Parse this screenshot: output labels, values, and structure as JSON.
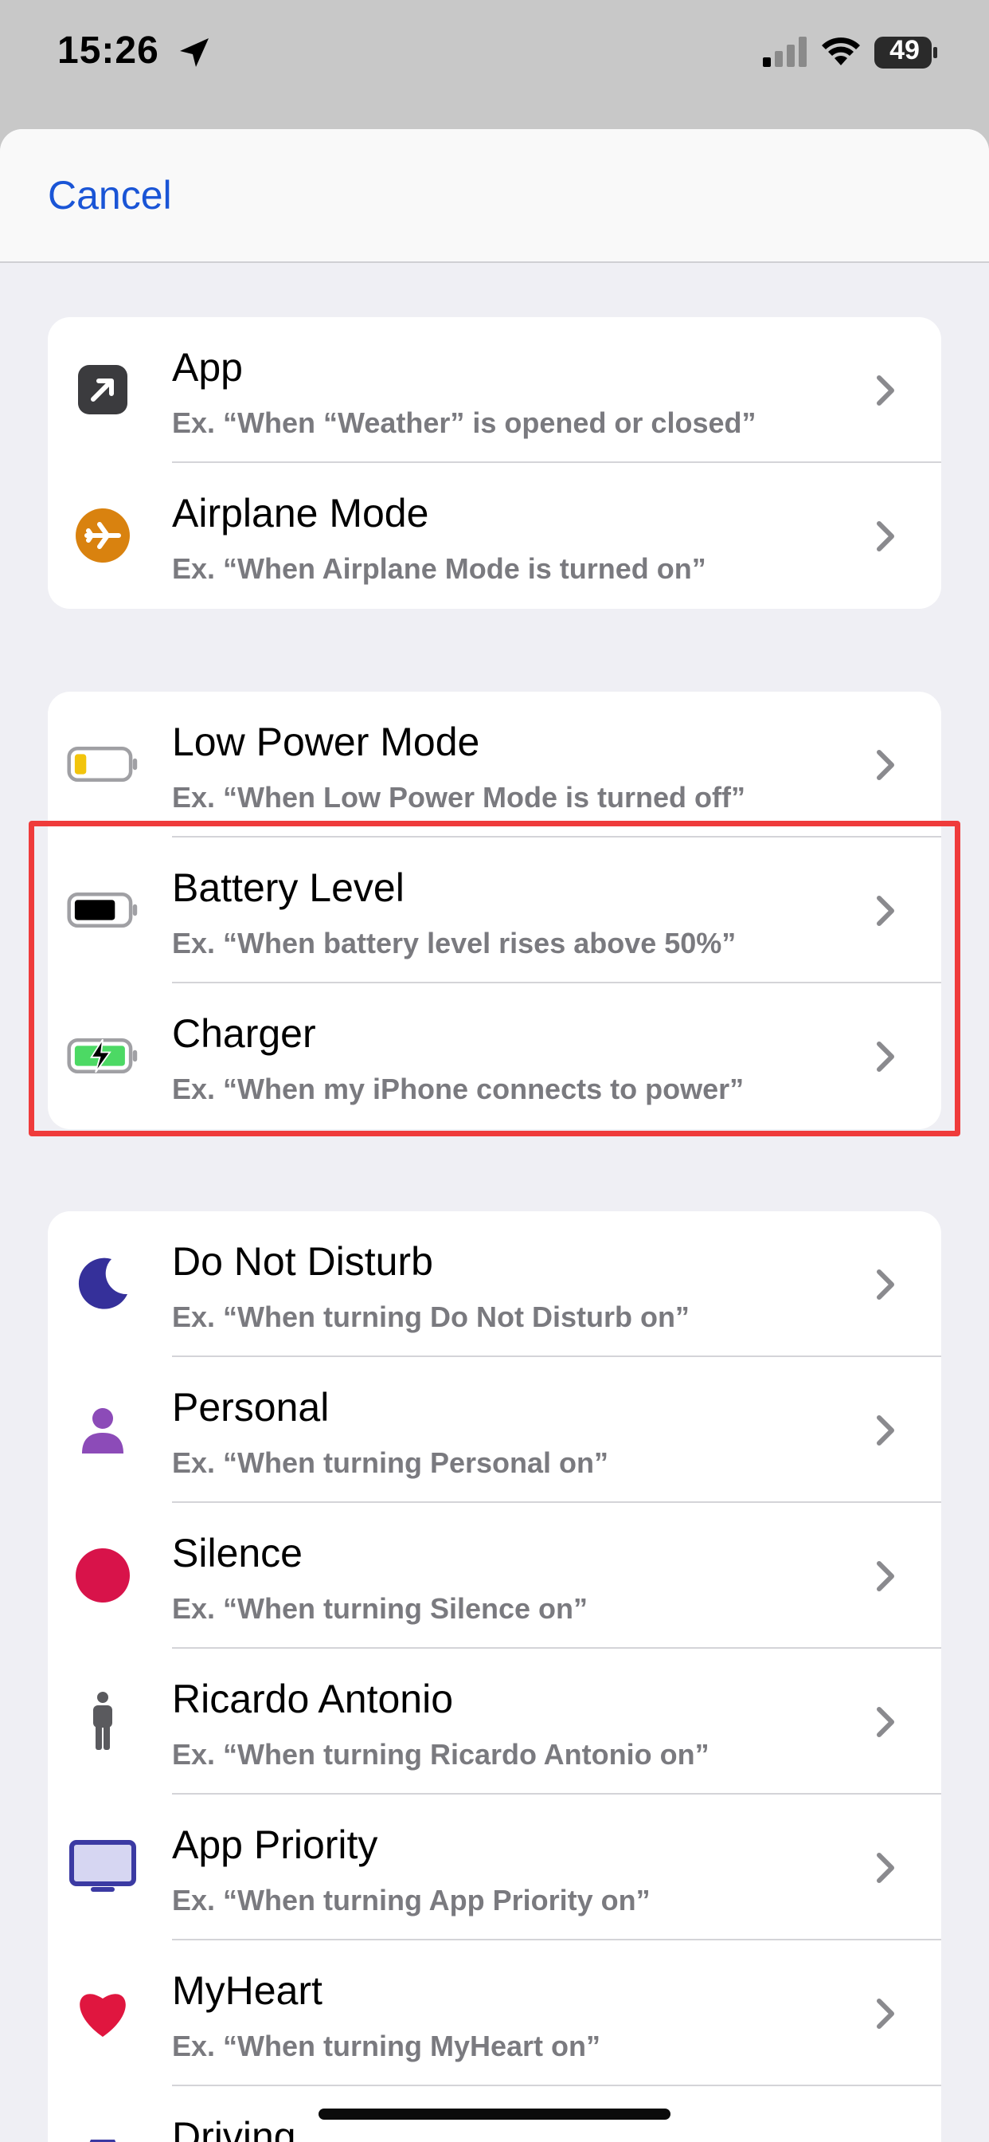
{
  "status_bar": {
    "time": "15:26",
    "battery": "49"
  },
  "header": {
    "cancel_label": "Cancel"
  },
  "groups": [
    {
      "rows": [
        {
          "title": "App",
          "subtitle": "Ex. “When “Weather” is opened or closed”",
          "icon": "app-arrow-icon"
        },
        {
          "title": "Airplane Mode",
          "subtitle": "Ex. “When Airplane Mode is turned on”",
          "icon": "airplane-icon"
        }
      ]
    },
    {
      "rows": [
        {
          "title": "Low Power Mode",
          "subtitle": "Ex. “When Low Power Mode is turned off”",
          "icon": "low-battery-icon"
        },
        {
          "title": "Battery Level",
          "subtitle": "Ex. “When battery level rises above 50%”",
          "icon": "battery-level-icon"
        },
        {
          "title": "Charger",
          "subtitle": "Ex. “When my iPhone connects to power”",
          "icon": "charger-icon"
        }
      ]
    },
    {
      "rows": [
        {
          "title": "Do Not Disturb",
          "subtitle": "Ex. “When turning Do Not Disturb on”",
          "icon": "moon-icon"
        },
        {
          "title": "Personal",
          "subtitle": "Ex. “When turning Personal on”",
          "icon": "person-icon"
        },
        {
          "title": "Silence",
          "subtitle": "Ex. “When turning Silence  on”",
          "icon": "red-circle-icon"
        },
        {
          "title": "Ricardo Antonio",
          "subtitle": "Ex. “When turning Ricardo Antonio on”",
          "icon": "standing-person-icon"
        },
        {
          "title": "App Priority",
          "subtitle": "Ex. “When turning App Priority  on”",
          "icon": "monitor-icon"
        },
        {
          "title": "MyHeart",
          "subtitle": "Ex. “When turning MyHeart on”",
          "icon": "heart-icon"
        },
        {
          "title": "Driving",
          "subtitle": "",
          "icon": "car-icon"
        }
      ]
    }
  ],
  "colors": {
    "accent": "#1a55d6",
    "highlight": "#ef3b3b",
    "airplane": "#d9820f",
    "moon": "#35309a",
    "personal": "#8c4bb8",
    "silence": "#d8134a",
    "monitor": "#3b3aa3",
    "heart": "#e0163f"
  }
}
